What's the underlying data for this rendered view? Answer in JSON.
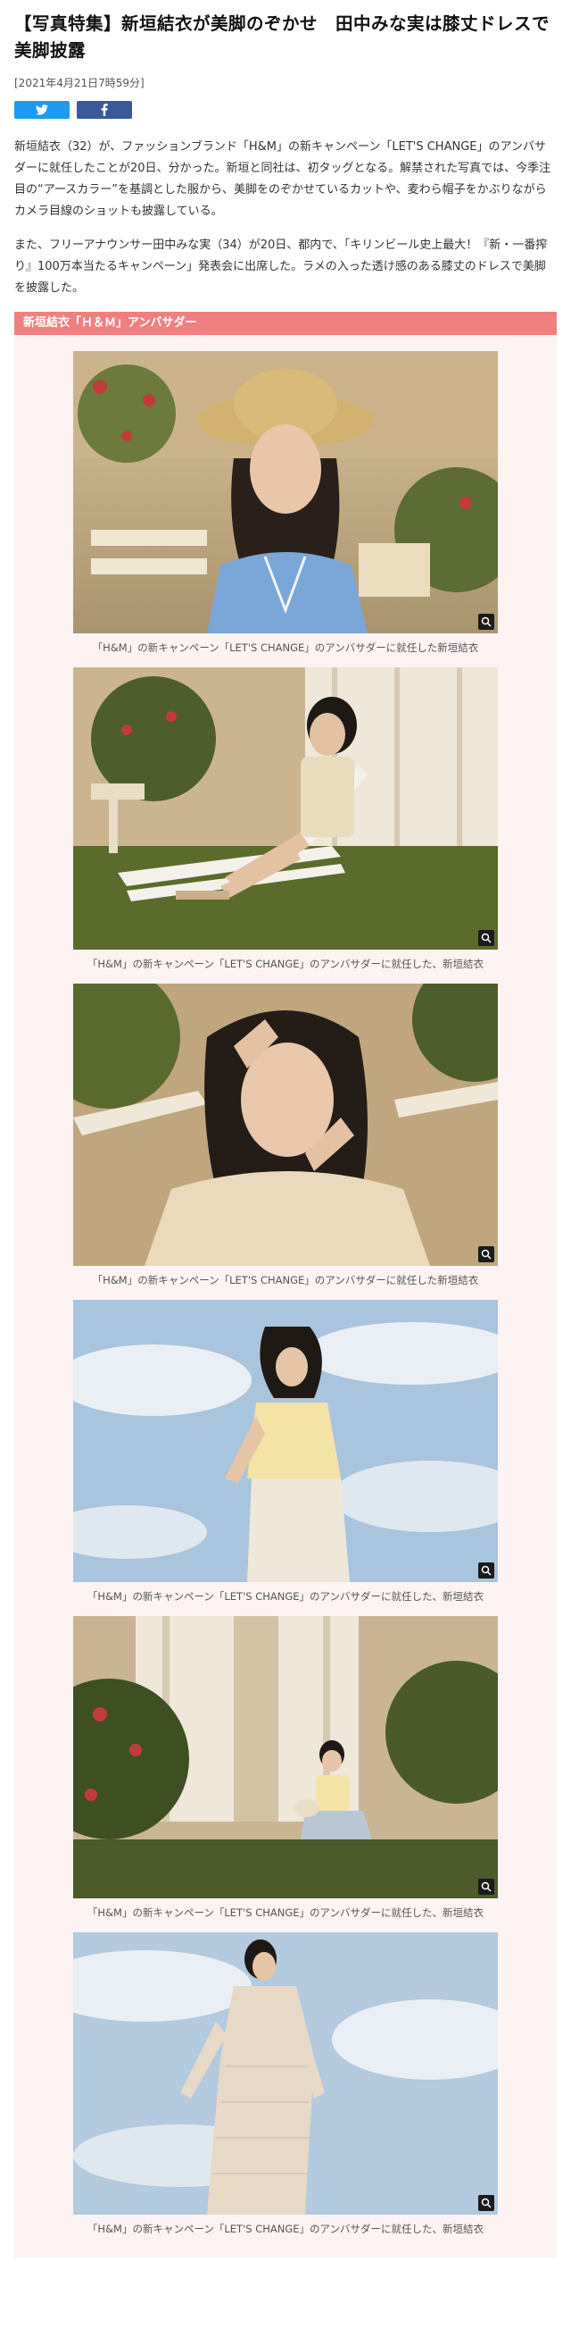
{
  "article": {
    "title": "【写真特集】新垣結衣が美脚のぞかせ　田中みな実は膝丈ドレスで美脚披露",
    "date": "[2021年4月21日7時59分]",
    "share": {
      "twitter_icon": "twitter-bird-icon",
      "facebook_icon": "facebook-f-icon"
    },
    "paragraphs": [
      "新垣結衣（32）が、ファッションブランド「H&M」の新キャンペーン「LET'S CHANGE」のアンバサダーに就任したことが20日、分かった。新垣と同社は、初タッグとなる。解禁された写真では、今季注目の“アースカラー”を基調とした服から、美脚をのぞかせているカットや、麦わら帽子をかぶりながらカメラ目線のショットも披露している。",
      "また、フリーアナウンサー田中みな実（34）が20日、都内で、「キリンビール史上最大！『新・一番搾り』100万本当たるキャンペーン」発表会に出席した。ラメの入った透け感のある膝丈のドレスで美脚を披露した。"
    ],
    "section_title": "新垣結衣「Ｈ＆Ｍ」アンバサダー"
  },
  "gallery": [
    {
      "caption": "「H&M」の新キャンペーン「LET'S CHANGE」のアンバサダーに就任した新垣結衣",
      "zoom_icon": "zoom-in-icon"
    },
    {
      "caption": "「H&M」の新キャンペーン「LET'S CHANGE」のアンバサダーに就任した、新垣結衣",
      "zoom_icon": "zoom-in-icon"
    },
    {
      "caption": "「H&M」の新キャンペーン「LET'S CHANGE」のアンバサダーに就任した新垣結衣",
      "zoom_icon": "zoom-in-icon"
    },
    {
      "caption": "「H&M」の新キャンペーン「LET'S CHANGE」のアンバサダーに就任した、新垣結衣",
      "zoom_icon": "zoom-in-icon"
    },
    {
      "caption": "「H&M」の新キャンペーン「LET'S CHANGE」のアンバサダーに就任した、新垣結衣",
      "zoom_icon": "zoom-in-icon"
    },
    {
      "caption": "「H&M」の新キャンペーン「LET'S CHANGE」のアンバサダーに就任した、新垣結衣",
      "zoom_icon": "zoom-in-icon"
    }
  ],
  "colors": {
    "section_bar": "#f08080",
    "twitter": "#1d9bf0",
    "facebook": "#3b5998",
    "gallery_bg": "#fdf3f3"
  }
}
